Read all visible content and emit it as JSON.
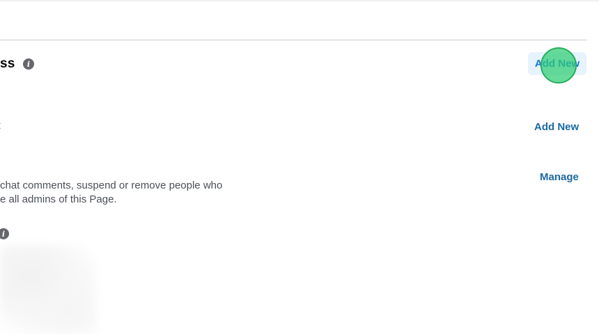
{
  "section": {
    "title": "ss",
    "info_icon_glyph": "i",
    "add_new_label": "Add New"
  },
  "row_one": {
    "partial_label": "t",
    "add_new_label": "Add New"
  },
  "row_two": {
    "description_lines": [
      "chat comments, suspend or remove people who",
      "e all admins of this Page."
    ],
    "manage_label": "Manage"
  },
  "row_three": {
    "info_icon_glyph": "i"
  },
  "colors": {
    "link": "#1b6aa3",
    "primary_button_bg": "#e7f3ff",
    "click_marker": "#2ecc71"
  },
  "icons": {
    "section_info": "info-icon",
    "row_three_info": "info-icon"
  }
}
